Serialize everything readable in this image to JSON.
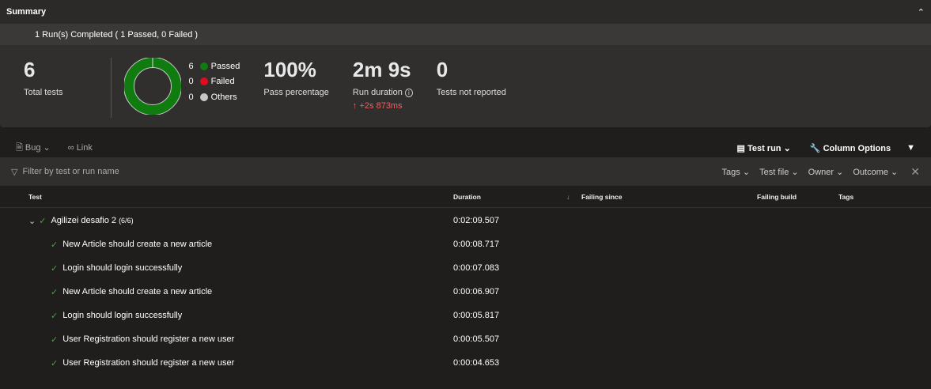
{
  "summary": {
    "title": "Summary",
    "runs_completed": "1 Run(s) Completed ( 1 Passed, 0 Failed )",
    "total": "6",
    "total_label": "Total tests",
    "legend": [
      {
        "count": "6",
        "label": "Passed",
        "color": "#107c10"
      },
      {
        "count": "0",
        "label": "Failed",
        "color": "#e00b1c"
      },
      {
        "count": "0",
        "label": "Others",
        "color": "#c8c8c8"
      }
    ],
    "pass_pct": "100%",
    "pass_label": "Pass percentage",
    "duration": "2m 9s",
    "duration_label": "Run duration",
    "duration_delta": "+2s 873ms",
    "not_reported": "0",
    "not_reported_label": "Tests not reported"
  },
  "toolbar": {
    "bug": "Bug",
    "link": "Link",
    "test_run": "Test run",
    "column_options": "Column Options"
  },
  "filter": {
    "placeholder": "Filter by test or run name",
    "tags": "Tags",
    "test_file": "Test file",
    "owner": "Owner",
    "outcome": "Outcome"
  },
  "columns": {
    "test": "Test",
    "duration": "Duration",
    "failing_since": "Failing since",
    "failing_build": "Failing build",
    "tags": "Tags"
  },
  "group": {
    "name": "Agilizei desafio 2",
    "count": "(6/6)",
    "duration": "0:02:09.507"
  },
  "rows": [
    {
      "name": "New Article should create a new article",
      "duration": "0:00:08.717"
    },
    {
      "name": "Login should login successfully",
      "duration": "0:00:07.083"
    },
    {
      "name": "New Article should create a new article",
      "duration": "0:00:06.907"
    },
    {
      "name": "Login should login successfully",
      "duration": "0:00:05.817"
    },
    {
      "name": "User Registration should register a new user",
      "duration": "0:00:05.507"
    },
    {
      "name": "User Registration should register a new user",
      "duration": "0:00:04.653"
    }
  ]
}
